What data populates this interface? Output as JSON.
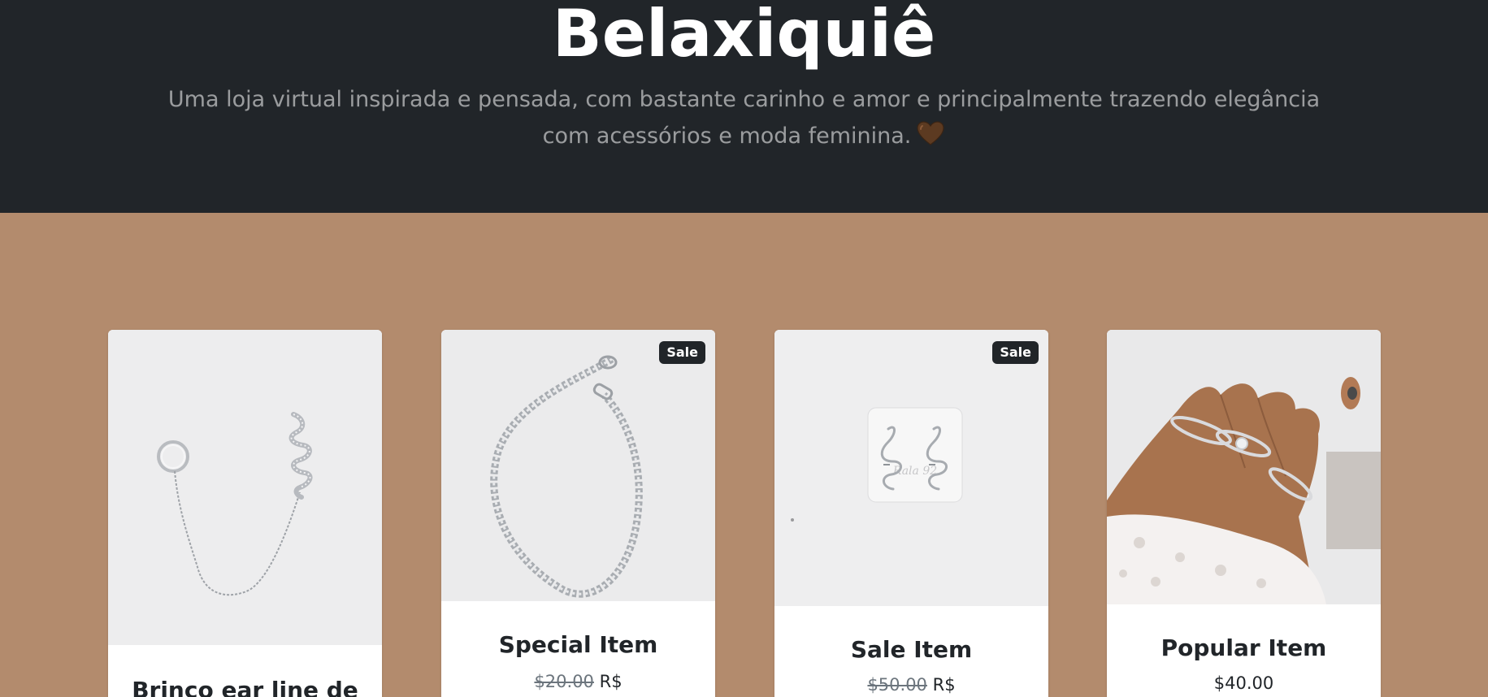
{
  "header": {
    "title": "Belaxiquiê",
    "tagline": "Uma loja virtual inspirada e pensada, com bastante carinho e amor e principalmente trazendo elegância com acessórios e moda feminina.",
    "heart_icon": "brown-heart-icon",
    "background_color": "#212529"
  },
  "theme": {
    "page_background": "#b38b6d",
    "badge_background": "#212529"
  },
  "products": [
    {
      "name": "Brinco ear line de",
      "image_icon": "ear-cuff-chain-earring-image",
      "sale_badge": "",
      "price_old": "",
      "price": ""
    },
    {
      "name": "Special Item",
      "image_icon": "silver-chain-bracelet-image",
      "sale_badge": "Sale",
      "price_old": "$20.00",
      "price": "R$"
    },
    {
      "name": "Sale Item",
      "image_icon": "snake-earrings-image",
      "sale_badge": "Sale",
      "price_old": "$50.00",
      "price": "R$"
    },
    {
      "name": "Popular Item",
      "image_icon": "rings-on-hand-image",
      "sale_badge": "",
      "price_old": "",
      "price": "$40.00"
    }
  ]
}
